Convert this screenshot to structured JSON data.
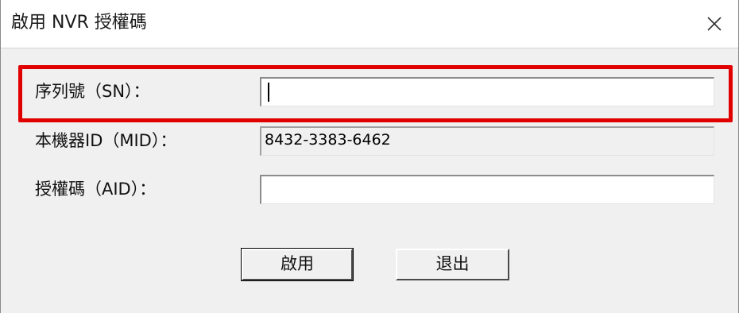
{
  "window": {
    "title": "啟用 NVR 授權碼",
    "close_glyph": "✕"
  },
  "form": {
    "serial": {
      "label": "序列號（SN）：",
      "value": ""
    },
    "machine_id": {
      "label": "本機器ID（MID）：",
      "value": "8432-3383-6462"
    },
    "auth_code": {
      "label": "授權碼（AID）：",
      "value": ""
    }
  },
  "buttons": {
    "activate": "啟用",
    "exit": "退出"
  },
  "annotation": {
    "highlight_color": "#e10000"
  }
}
